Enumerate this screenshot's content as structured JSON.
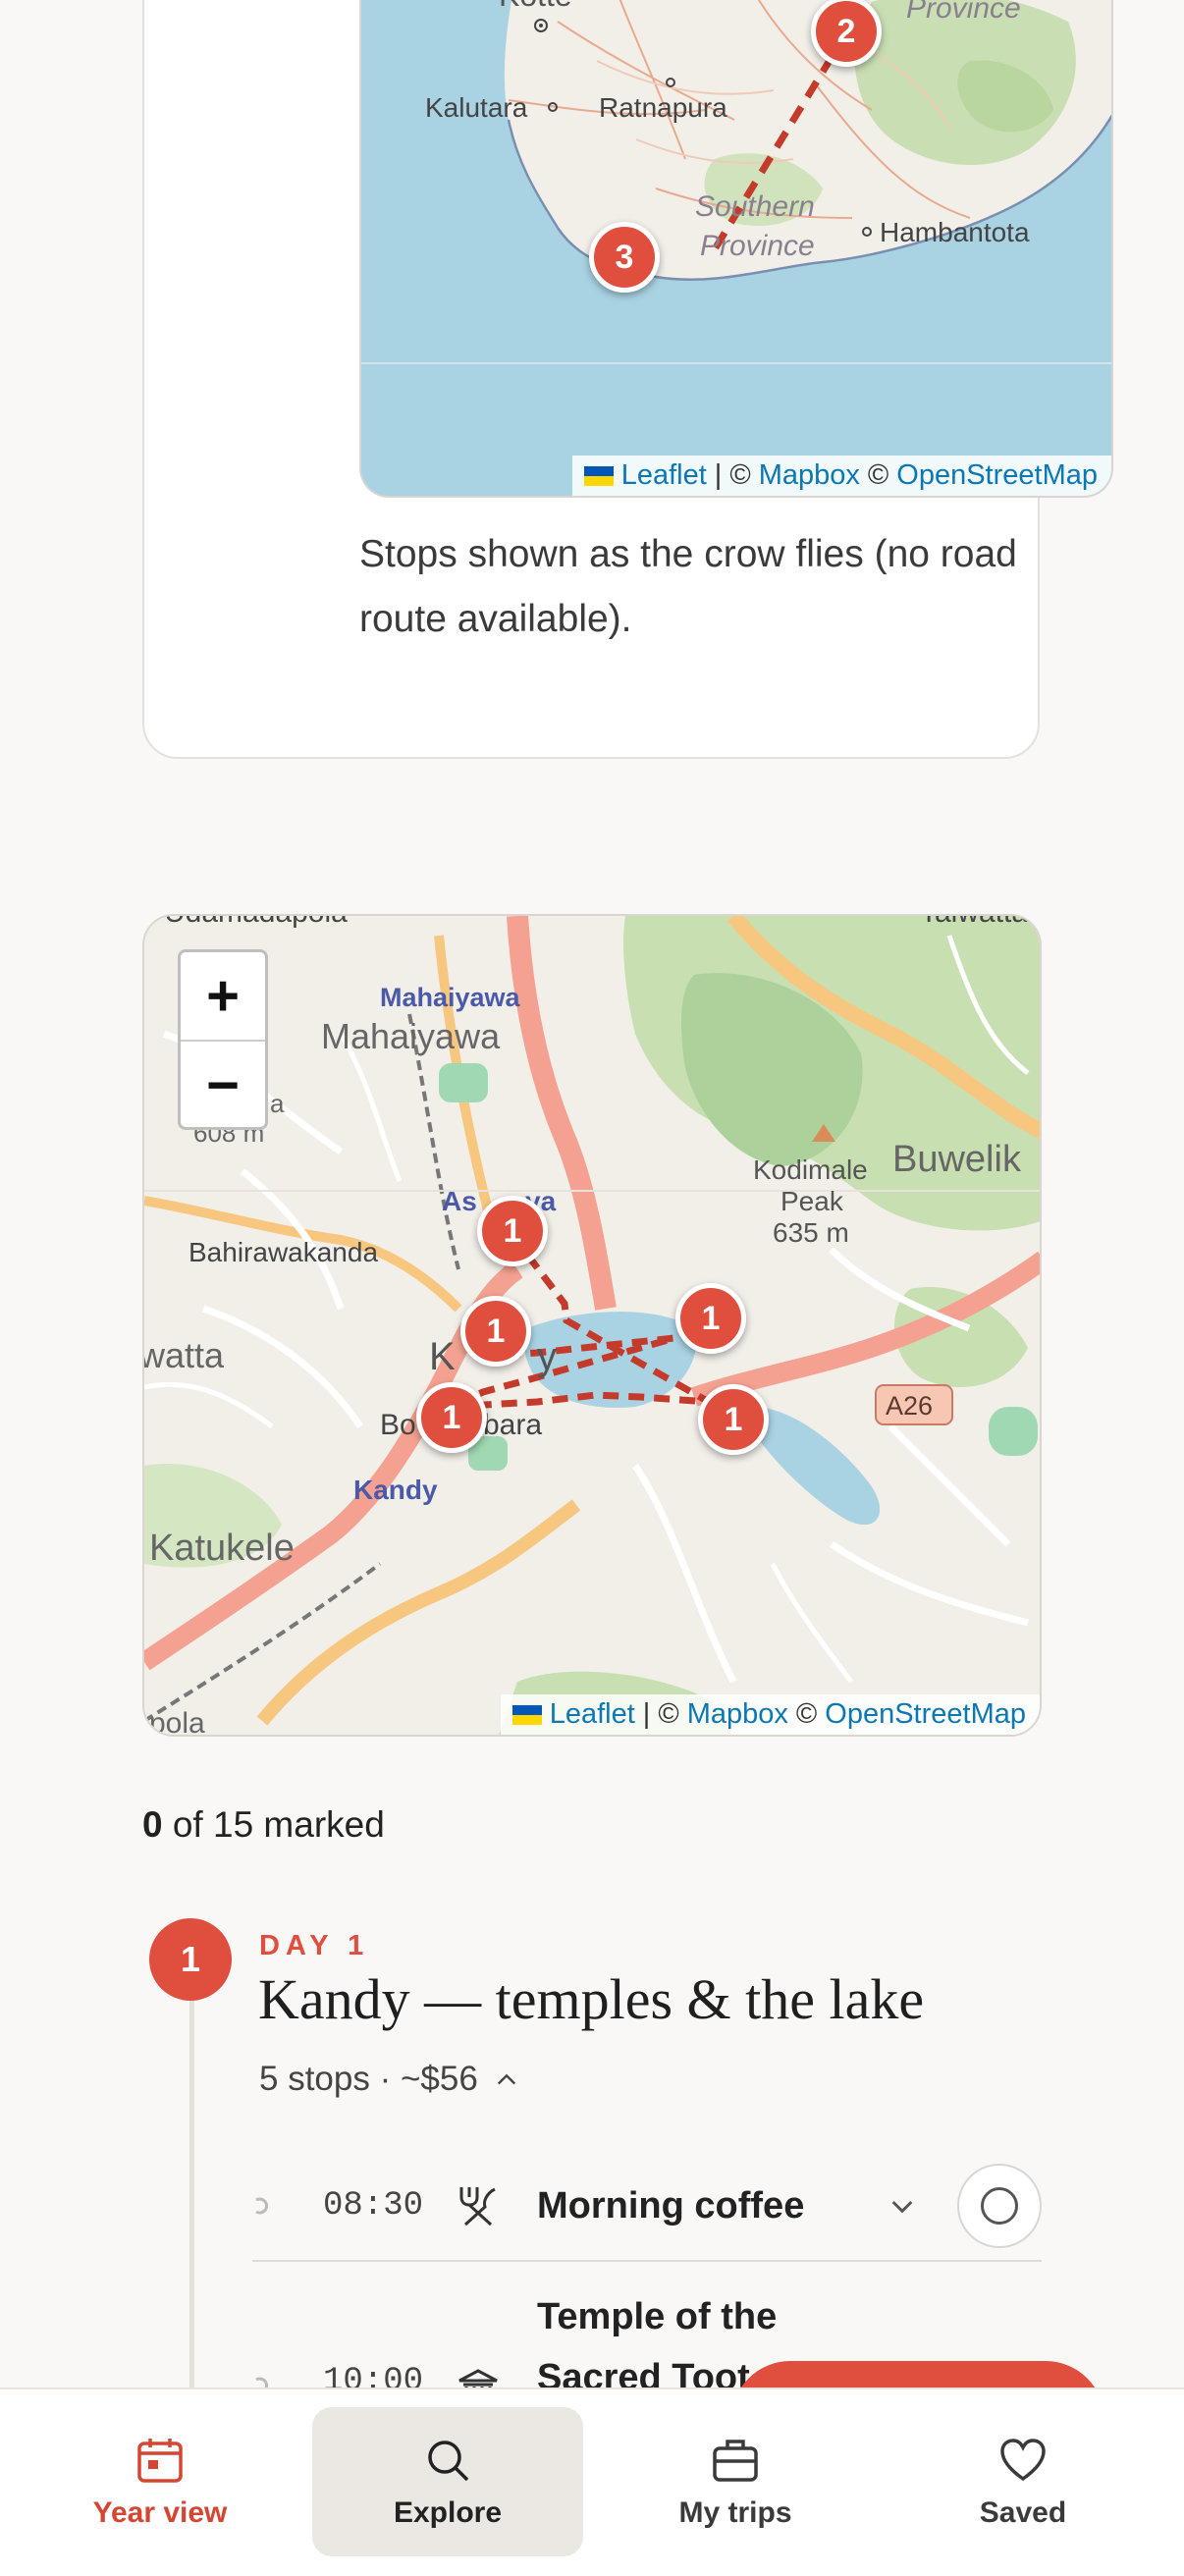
{
  "route_card": {
    "map": {
      "labels": {
        "kotte": "Kotte",
        "province_top": "Province",
        "kalutara": "Kalutara",
        "ratnapura": "Ratnapura",
        "southern": "Southern",
        "province": "Province",
        "hambantota": "Hambantota"
      },
      "markers": [
        "2",
        "3"
      ]
    },
    "attribution": {
      "leaflet": "Leaflet",
      "sep": "|",
      "copy1": "©",
      "mapbox": "Mapbox",
      "copy2": "©",
      "osm": "OpenStreetMap"
    },
    "caption": "Stops shown as the crow flies (no road route available)."
  },
  "day_map": {
    "labels": {
      "udamadapola": "Udamadapola",
      "talwatta": "Talwatta",
      "mahaiyawa_blue": "Mahaiyawa",
      "mahaiyawa": "Mahaiyawa",
      "elev608": "608 m",
      "a": "a",
      "kodimale1": "Kodimale",
      "kodimale2": "Peak",
      "kodimale3": "635 m",
      "buwelik": "Buwelik",
      "asgiriya": "As",
      "ya": "ya",
      "bahirawakanda": "Bahirawakanda",
      "watta": "watta",
      "k": "K",
      "y": "y",
      "bo": "Bo",
      "bara": "bara",
      "kandy": "Kandy",
      "a26": "A26",
      "katukele": "Katukele",
      "pola": "pola"
    },
    "zoom_in": "+",
    "zoom_out": "−",
    "markers": [
      "1",
      "1",
      "1",
      "1",
      "1"
    ],
    "attribution": {
      "leaflet": "Leaflet",
      "sep": "|",
      "copy1": "©",
      "mapbox": "Mapbox",
      "copy2": "©",
      "osm": "OpenStreetMap"
    }
  },
  "progress": {
    "count": "0",
    "rest": " of 15 marked"
  },
  "day": {
    "number": "1",
    "label": "DAY 1",
    "title": "Kandy — temples & the lake",
    "meta": "5 stops · ~$56",
    "stops": [
      {
        "time": "08:30",
        "icon": "cutlery-icon",
        "title": "Morning coffee"
      },
      {
        "time": "10:00",
        "icon": "temple-icon",
        "title_line1": "Temple of the",
        "title_line2": "Sacred Toot"
      }
    ]
  },
  "nav": {
    "items": [
      {
        "label": "Year view",
        "icon": "calendar-icon"
      },
      {
        "label": "Explore",
        "icon": "search-icon"
      },
      {
        "label": "My trips",
        "icon": "briefcase-icon"
      },
      {
        "label": "Saved",
        "icon": "heart-icon"
      }
    ]
  },
  "colors": {
    "accent": "#e04f3d",
    "link": "#0b78b5",
    "water": "#a9d3e3"
  }
}
